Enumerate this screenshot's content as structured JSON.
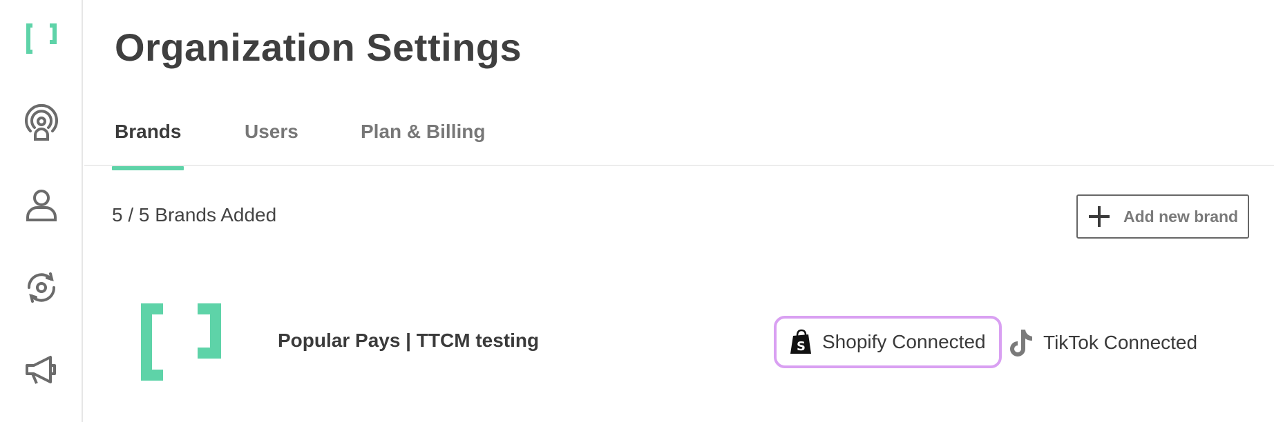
{
  "colors": {
    "accent": "#5ed3a8",
    "highlight": "#d9a0f2",
    "text": "#3a3a3a",
    "muted": "#777777"
  },
  "sidebar": {
    "items": [
      {
        "icon": "bracket-logo-icon"
      },
      {
        "icon": "broadcast-icon"
      },
      {
        "icon": "user-icon"
      },
      {
        "icon": "sync-icon"
      },
      {
        "icon": "megaphone-icon"
      }
    ]
  },
  "header": {
    "title": "Organization Settings"
  },
  "tabs": [
    {
      "label": "Brands",
      "active": true
    },
    {
      "label": "Users",
      "active": false
    },
    {
      "label": "Plan & Billing",
      "active": false
    }
  ],
  "brands_section": {
    "count_text": "5 / 5 Brands Added",
    "add_button_label": "Add new brand"
  },
  "brand_rows": [
    {
      "name": "Popular Pays | TTCM testing",
      "logo_icon": "bracket-logo-icon",
      "shopify_label": "Shopify Connected",
      "tiktok_label": "TikTok Connected",
      "settings_icon": "gear-icon"
    }
  ]
}
